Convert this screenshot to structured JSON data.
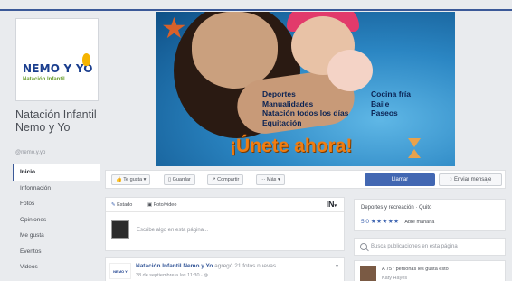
{
  "page": {
    "logo_text": "Nemo y Yo",
    "logo_subtitle": "Natación Infantil",
    "name": "Natación Infantil Nemo y Yo",
    "handle": "@nemo.y.yo"
  },
  "nav": {
    "items": [
      "Inicio",
      "Información",
      "Fotos",
      "Opiniones",
      "Me gusta",
      "Eventos",
      "Videos"
    ],
    "active": "Inicio"
  },
  "cover": {
    "activities_left": [
      "Deportes",
      "Manualidades",
      "Natación todos los días",
      "Equitación"
    ],
    "activities_right": [
      "Cocina fría",
      "Baile",
      "Paseos"
    ],
    "slogan": "¡Únete ahora!"
  },
  "actions": {
    "like": "Te gusta",
    "save": "Guardar",
    "share": "Compartir",
    "more": "Más",
    "call": "Llamar",
    "message": "Enviar mensaje"
  },
  "composer": {
    "tab_status": "Estado",
    "tab_photo": "Foto/video",
    "brand_glyph": "IN",
    "placeholder": "Escribe algo en esta página..."
  },
  "post": {
    "author": "Natación Infantil Nemo y Yo",
    "action": "agregó 21 fotos nuevas.",
    "date": "28 de septiembre a las 11:30 · "
  },
  "info": {
    "category": "Deportes y recreación · Quito",
    "rating": "5.0",
    "stars": "★★★★★",
    "open_status": "Abre mañana"
  },
  "search": {
    "placeholder": "Busca publicaciones en esta página"
  },
  "likes": {
    "text": "A 757 personas les gusta esto",
    "name": "Katy Hayes"
  },
  "colors": {
    "brand_blue": "#3b5998",
    "button_blue": "#4267b2",
    "slogan_orange": "#f07d12"
  }
}
